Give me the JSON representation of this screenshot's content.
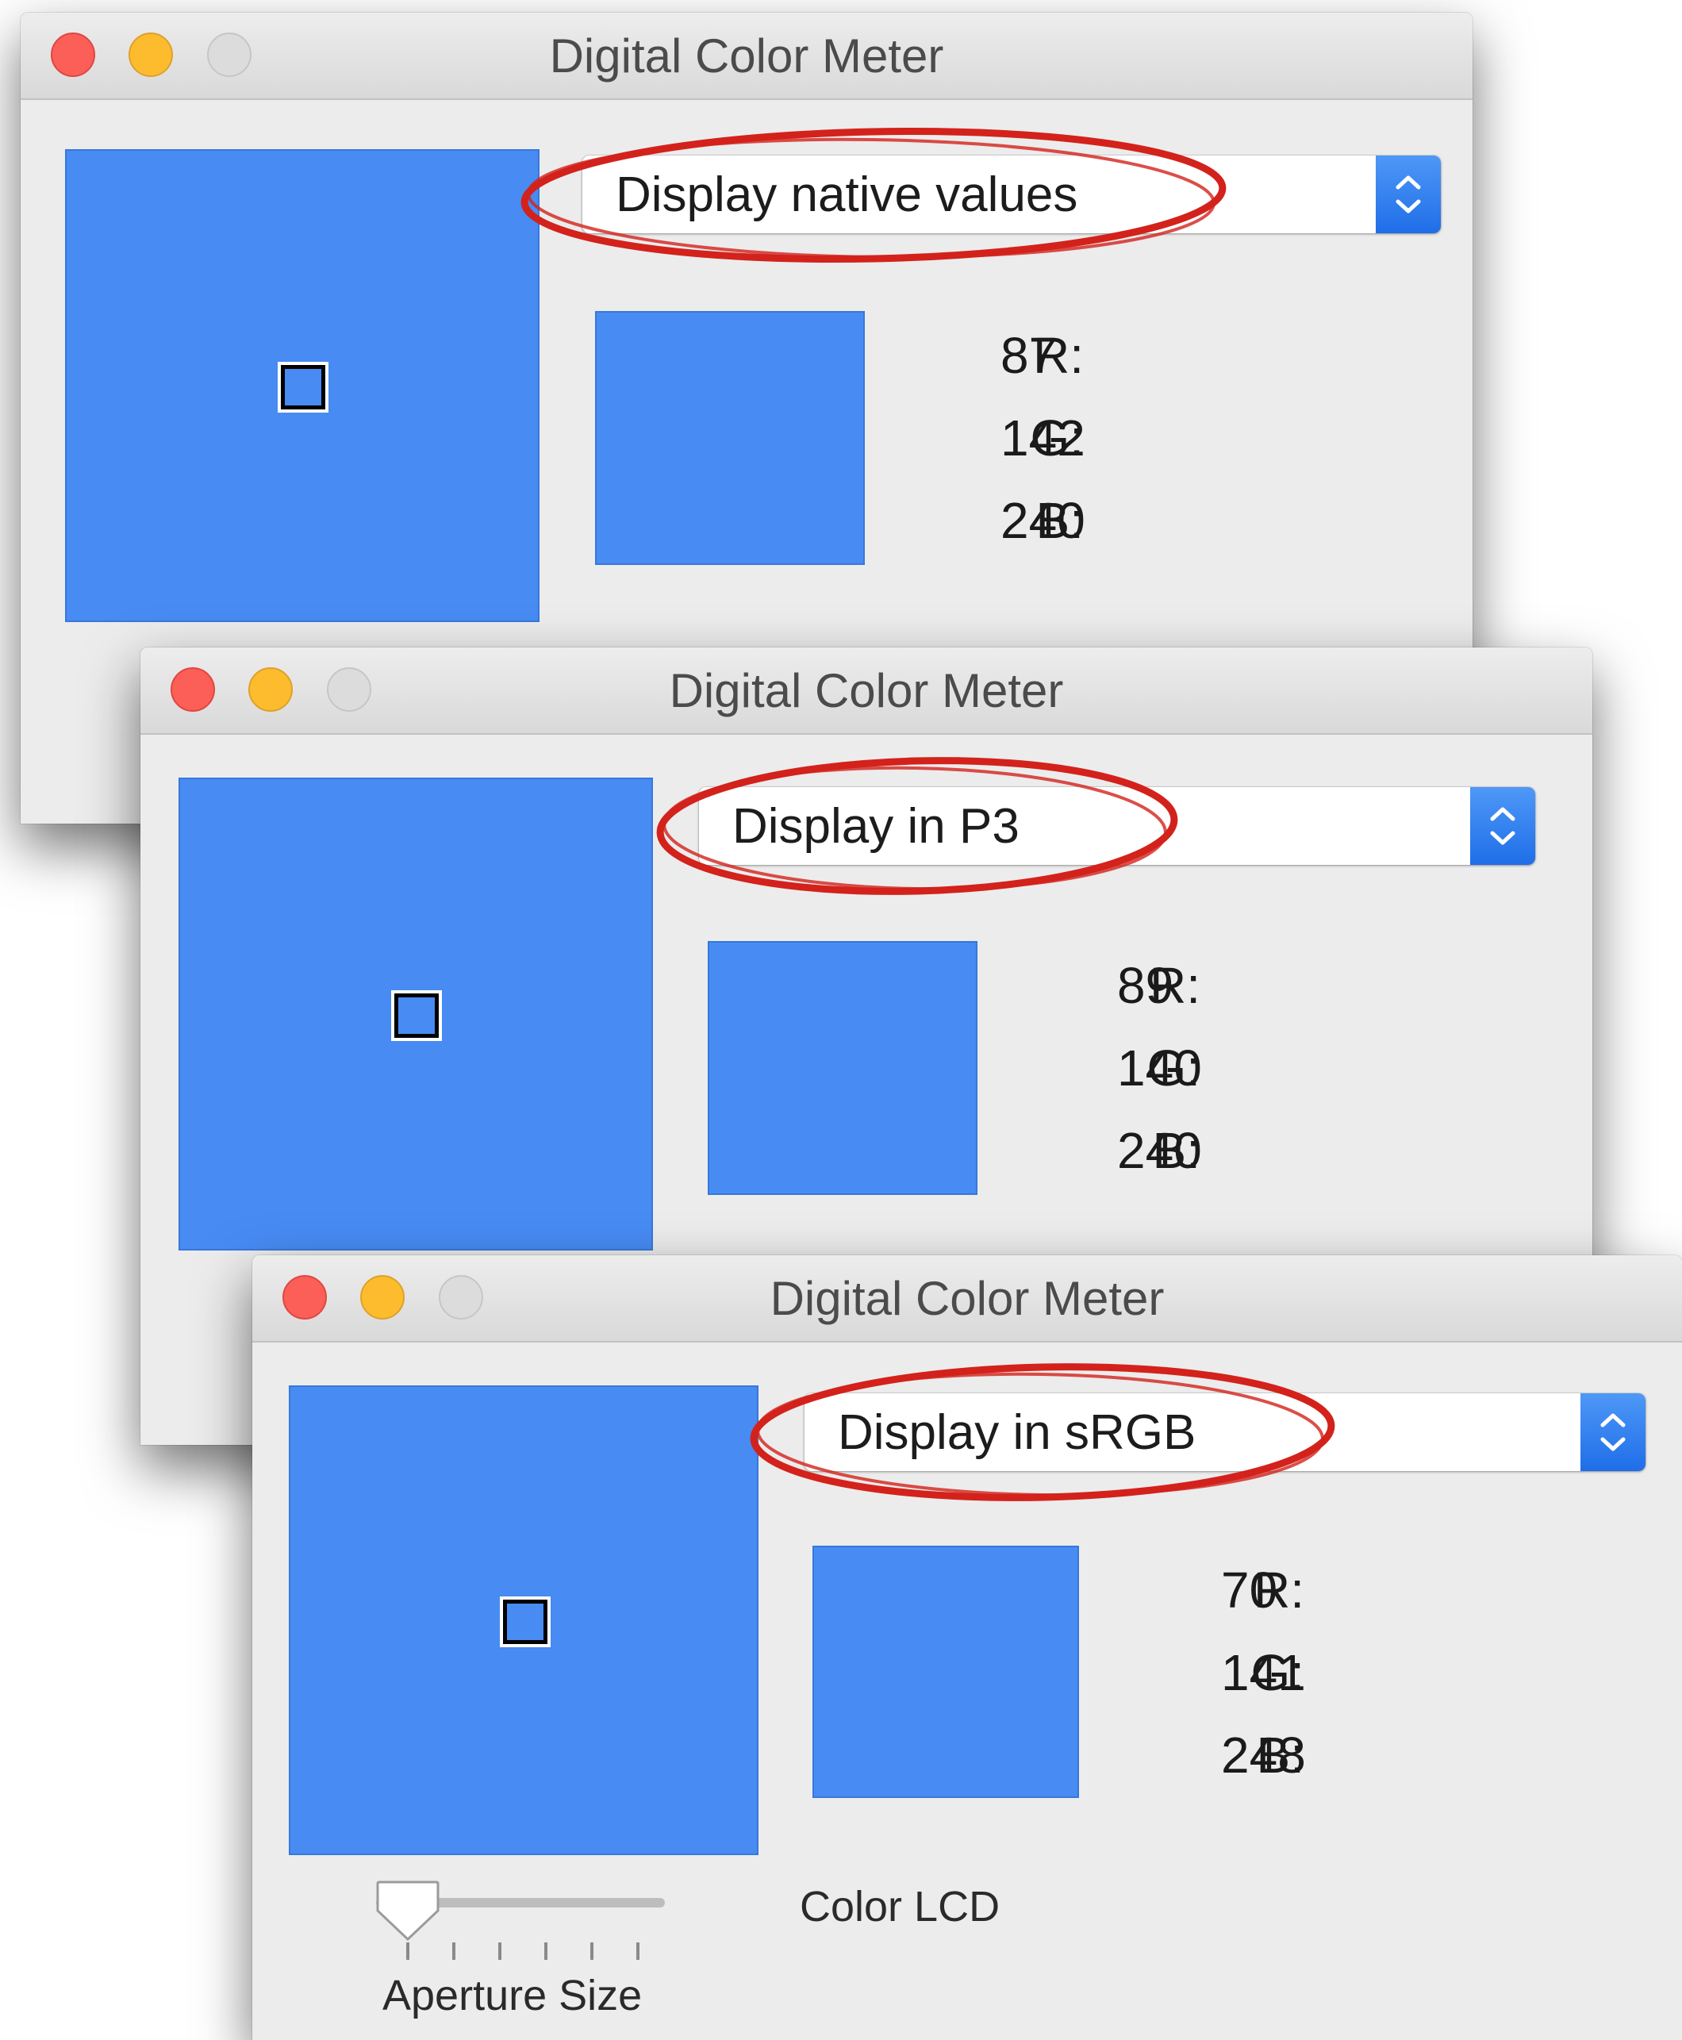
{
  "windows": [
    {
      "title": "Digital Color Meter",
      "popup": "Display native values",
      "readout": [
        {
          "label": "R:",
          "value": "87"
        },
        {
          "label": "G:",
          "value": "142"
        },
        {
          "label": "B:",
          "value": "240"
        }
      ],
      "swatch_color": "#478bf3"
    },
    {
      "title": "Digital Color Meter",
      "popup": "Display in P3",
      "readout": [
        {
          "label": "R:",
          "value": "89"
        },
        {
          "label": "G:",
          "value": "140"
        },
        {
          "label": "B:",
          "value": "240"
        }
      ],
      "swatch_color": "#478bf3"
    },
    {
      "title": "Digital Color Meter",
      "popup": "Display in sRGB",
      "readout": [
        {
          "label": "R:",
          "value": "70"
        },
        {
          "label": "G:",
          "value": "141"
        },
        {
          "label": "B:",
          "value": "248"
        }
      ],
      "swatch_color": "#478bf3",
      "aperture_label": "Aperture Size",
      "aperture_level": 0,
      "display_name": "Color LCD"
    }
  ],
  "annotation_color": "#d3221b",
  "icons": [
    "close-button",
    "minimize-button",
    "zoom-button",
    "popup-stepper-icon",
    "aperture-square-icon"
  ]
}
